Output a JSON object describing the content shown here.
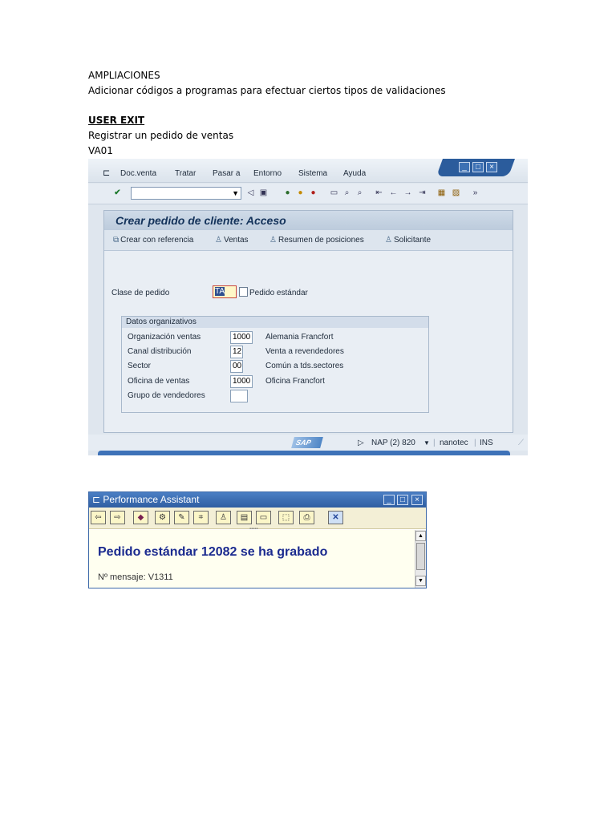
{
  "doc": {
    "line1": "AMPLIACIONES",
    "line2": "Adicionar códigos a programas para efectuar ciertos tipos de validaciones",
    "heading": "USER EXIT",
    "line3": "Registrar un pedido de ventas",
    "line4": "VA01"
  },
  "sap": {
    "menu": [
      "Doc.venta",
      "Tratar",
      "Pasar a",
      "Entorno",
      "Sistema",
      "Ayuda"
    ],
    "win_buttons": [
      "_",
      "□",
      "×"
    ],
    "panel_title": "Crear pedido de cliente: Acceso",
    "app_toolbar": [
      "Crear con referencia",
      "Ventas",
      "Resumen de posiciones",
      "Solicitante"
    ],
    "order_type": {
      "label": "Clase de pedido",
      "value": "TA",
      "description": "Pedido estándar"
    },
    "org_group": {
      "title": "Datos organizativos",
      "rows": [
        {
          "label": "Organización ventas",
          "value": "1000",
          "desc": "Alemania Francfort"
        },
        {
          "label": "Canal distribución",
          "value": "12",
          "desc": "Venta a revendedores"
        },
        {
          "label": "Sector",
          "value": "00",
          "desc": "Común a tds.sectores"
        },
        {
          "label": "Oficina de ventas",
          "value": "1000",
          "desc": "Oficina Francfort"
        },
        {
          "label": "Grupo de vendedores",
          "value": "",
          "desc": ""
        }
      ]
    },
    "status": {
      "logo": "SAP",
      "system": "NAP (2) 820",
      "user": "nanotec",
      "mode": "INS"
    }
  },
  "pa": {
    "title": "Performance Assistant",
    "heading": "Pedido estándar 12082 se ha grabado",
    "message": "Nº mensaje: V1311"
  }
}
